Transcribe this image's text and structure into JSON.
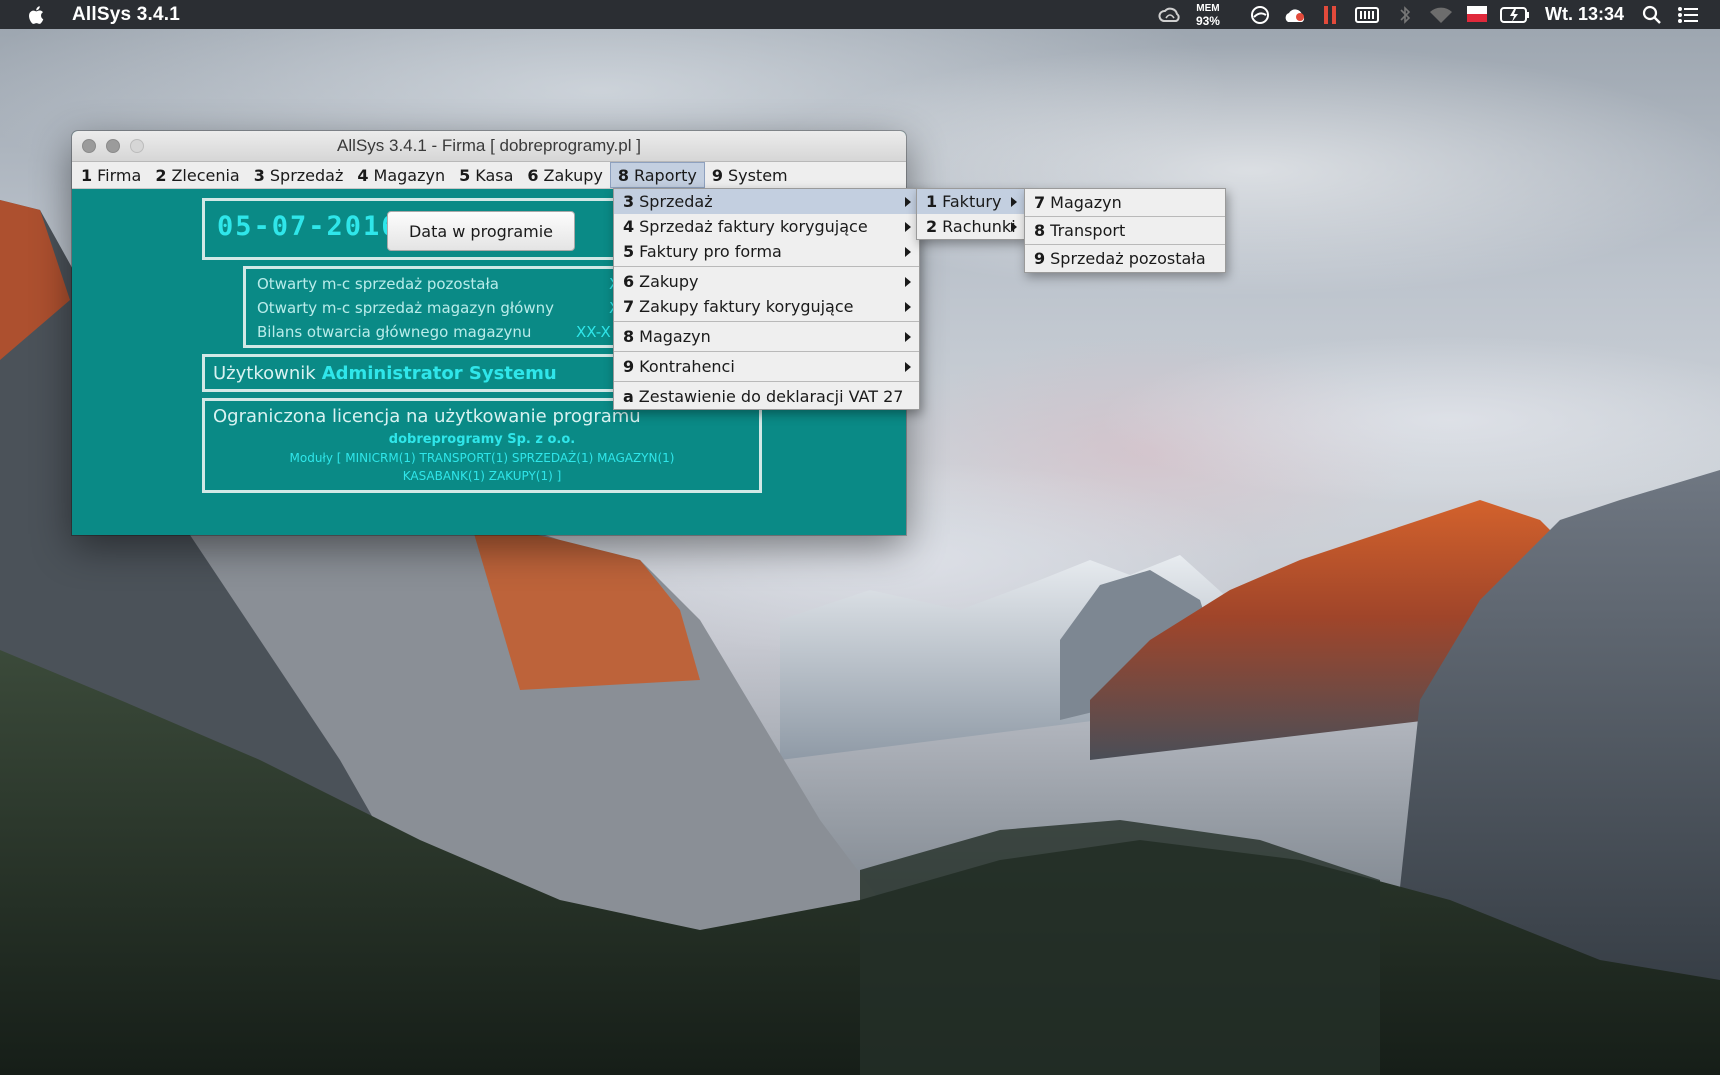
{
  "os_menubar": {
    "app_name": "AllSys 3.4.1",
    "mem_label": "MEM",
    "mem_value": "93%",
    "clock": "Wt. 13:34"
  },
  "window": {
    "title": "AllSys 3.4.1 - Firma [ dobreprogramy.pl ]",
    "menu": [
      {
        "key": "1",
        "label": "Firma"
      },
      {
        "key": "2",
        "label": "Zlecenia"
      },
      {
        "key": "3",
        "label": "Sprzedaż"
      },
      {
        "key": "4",
        "label": "Magazyn"
      },
      {
        "key": "5",
        "label": "Kasa"
      },
      {
        "key": "6",
        "label": "Zakupy"
      },
      {
        "key": "8",
        "label": "Raporty"
      },
      {
        "key": "9",
        "label": "System"
      }
    ],
    "date": "05-07-2016",
    "date_button": "Data w programie",
    "month_rows": [
      {
        "label": "Otwarty m-c sprzedaż pozostała",
        "value": "X"
      },
      {
        "label": "Otwarty m-c sprzedaż magazyn główny",
        "value": "X"
      },
      {
        "label": "Bilans otwarcia głównego magazynu",
        "value": "XX-X"
      }
    ],
    "user_label": "Użytkownik",
    "user_name": "Administrator Systemu",
    "license_title": "Ograniczona licencja na użytkowanie programu",
    "license_company": "dobreprogramy Sp. z o.o.",
    "license_modules_1": "Moduły [ MINICRM(1) TRANSPORT(1) SPRZEDAŻ(1) MAGAZYN(1)",
    "license_modules_2": "KASABANK(1) ZAKUPY(1) ]"
  },
  "raporty_menu": [
    {
      "key": "3",
      "label": "Sprzedaż",
      "submenu": true
    },
    {
      "key": "4",
      "label": "Sprzedaż faktury korygujące",
      "submenu": true
    },
    {
      "key": "5",
      "label": "Faktury pro forma",
      "submenu": true
    },
    {
      "key": "6",
      "label": "Zakupy",
      "submenu": true
    },
    {
      "key": "7",
      "label": "Zakupy faktury korygujące",
      "submenu": true
    },
    {
      "key": "8",
      "label": "Magazyn",
      "submenu": true
    },
    {
      "key": "9",
      "label": "Kontrahenci",
      "submenu": true
    },
    {
      "key": "a",
      "label": "Zestawienie do deklaracji VAT 27",
      "submenu": false
    }
  ],
  "sprzedaz_submenu": [
    {
      "key": "1",
      "label": "Faktury"
    },
    {
      "key": "2",
      "label": "Rachunki"
    }
  ],
  "faktury_submenu": [
    {
      "key": "7",
      "label": "Magazyn"
    },
    {
      "key": "8",
      "label": "Transport"
    },
    {
      "key": "9",
      "label": "Sprzedaż pozostała"
    }
  ],
  "colors": {
    "window_bg": "#0a8a86",
    "accent_text": "#2fe6ea",
    "menu_highlight": "#c3cfe0"
  }
}
